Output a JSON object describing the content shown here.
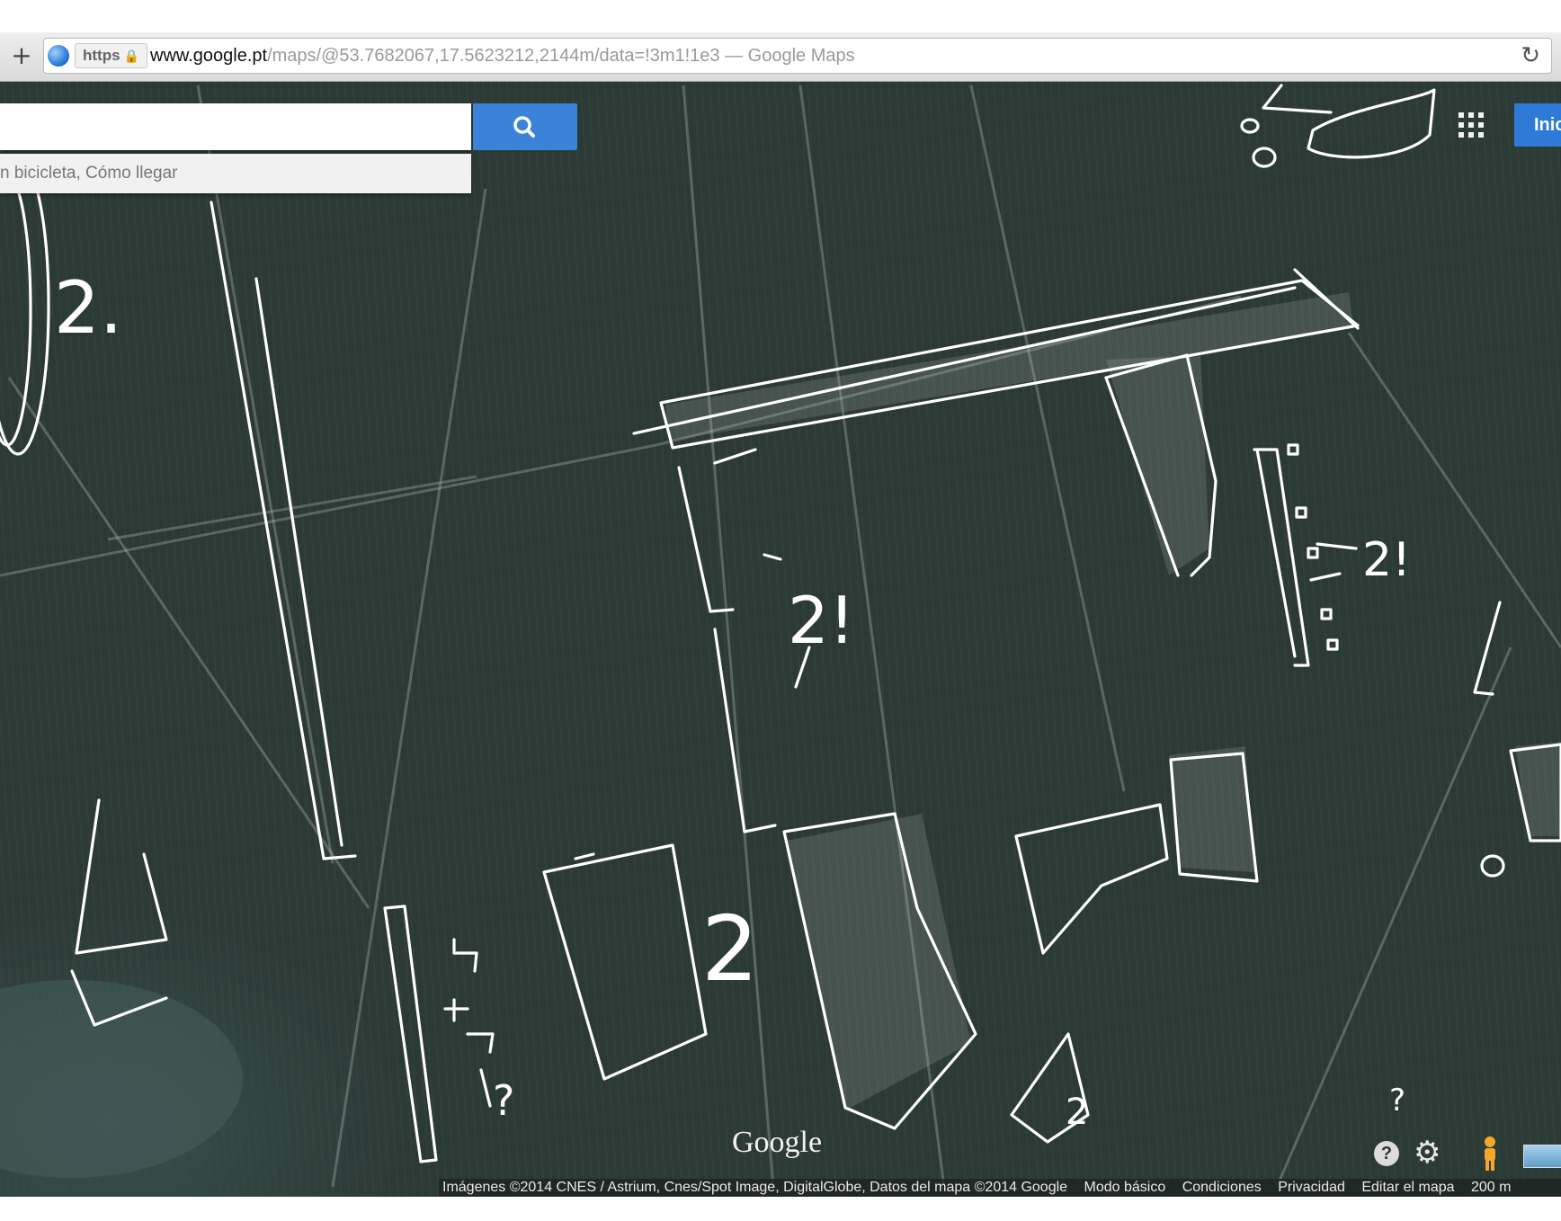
{
  "browser": {
    "new_tab_label": "+",
    "https_label": "https",
    "url_host": "www.google.pt",
    "url_path": "/maps/@53.7682067,17.5623212,2144m/data=!3m1!1e3",
    "url_separator_title": " — Google Maps",
    "reload_label": "↻"
  },
  "search": {
    "suggestion_text": "n bicicleta, Cómo llegar",
    "button_icon": "search-icon"
  },
  "header": {
    "apps_icon": "apps-grid-icon",
    "signin_label": "Inic"
  },
  "map": {
    "logo": "Google",
    "annotations": {
      "q_top_left": "2.",
      "warn_center": "2!",
      "warn_right": "2!",
      "q_center": "2",
      "q_bottom": "2",
      "q_small_bottom_right": "?"
    },
    "controls": {
      "help_label": "?",
      "settings_icon": "gear-icon",
      "pegman_icon": "pegman-icon",
      "map_type_icon": "map-thumbnail-icon"
    },
    "footer": {
      "attribution": "Imágenes ©2014 CNES / Astrium, Cnes/Spot Image, DigitalGlobe, Datos del mapa ©2014 Google",
      "links": [
        "Modo básico",
        "Condiciones",
        "Privacidad",
        "Editar el mapa"
      ],
      "scale": "200 m"
    }
  },
  "colors": {
    "map_base": "#2c3a36",
    "accent_blue": "#3b82d9",
    "chalk": "#ffffff"
  }
}
